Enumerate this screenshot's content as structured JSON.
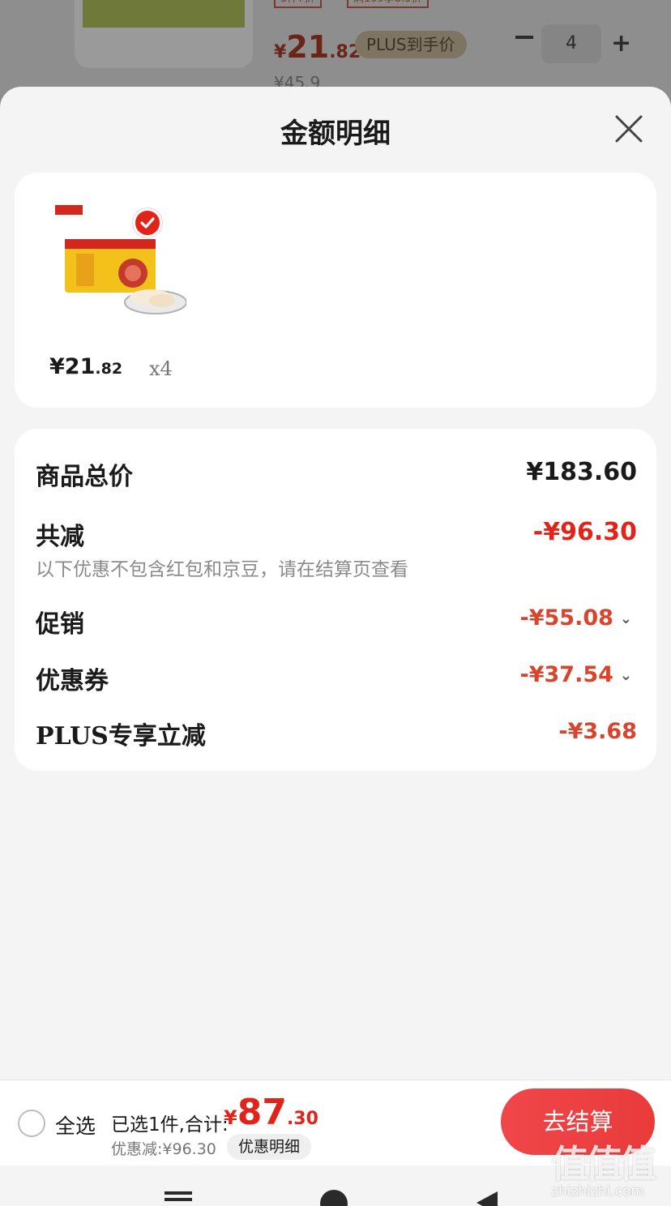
{
  "background": {
    "tags": [
      "3件7折",
      "满109享8.5折"
    ],
    "price": {
      "symbol": "¥",
      "integer": "21",
      "decimal": ".82"
    },
    "plus_badge": "PLUS到手价",
    "quantity": "4",
    "original_price": "¥45.9"
  },
  "sheet": {
    "title": "金额明细"
  },
  "product": {
    "unit_price": {
      "symbol": "¥",
      "integer": "21",
      "decimal": ".82"
    },
    "quantity": "x4",
    "image_icon": "dumpling-package-image",
    "selected": true
  },
  "summary": {
    "total_label": "商品总价",
    "total_value": "¥183.60",
    "reduced_label": "共减",
    "reduced_value": "-¥96.30",
    "note": "以下优惠不包含红包和京豆，请在结算页查看",
    "rows": [
      {
        "label": "促销",
        "value": "-¥55.08",
        "expandable": true
      },
      {
        "label": "优惠券",
        "value": "-¥37.54",
        "expandable": true
      },
      {
        "label": "PLUS专享立减",
        "value": "-¥3.68",
        "expandable": false
      }
    ]
  },
  "bottom_bar": {
    "select_all": "全选",
    "selected_text": "已选1件,合计:",
    "total": {
      "symbol": "¥",
      "integer": "87",
      "decimal": ".30"
    },
    "discount_text": "优惠减:¥96.30",
    "detail_button": "优惠明细",
    "checkout_button": "去结算"
  },
  "watermark": {
    "logo": "值值值",
    "url": "zhizhizhi.com"
  },
  "colors": {
    "accent_red": "#e2231a",
    "soft_red": "#d9442c",
    "checkout_gradient_start": "#f0464a",
    "sheet_background": "#f4f4f4"
  }
}
